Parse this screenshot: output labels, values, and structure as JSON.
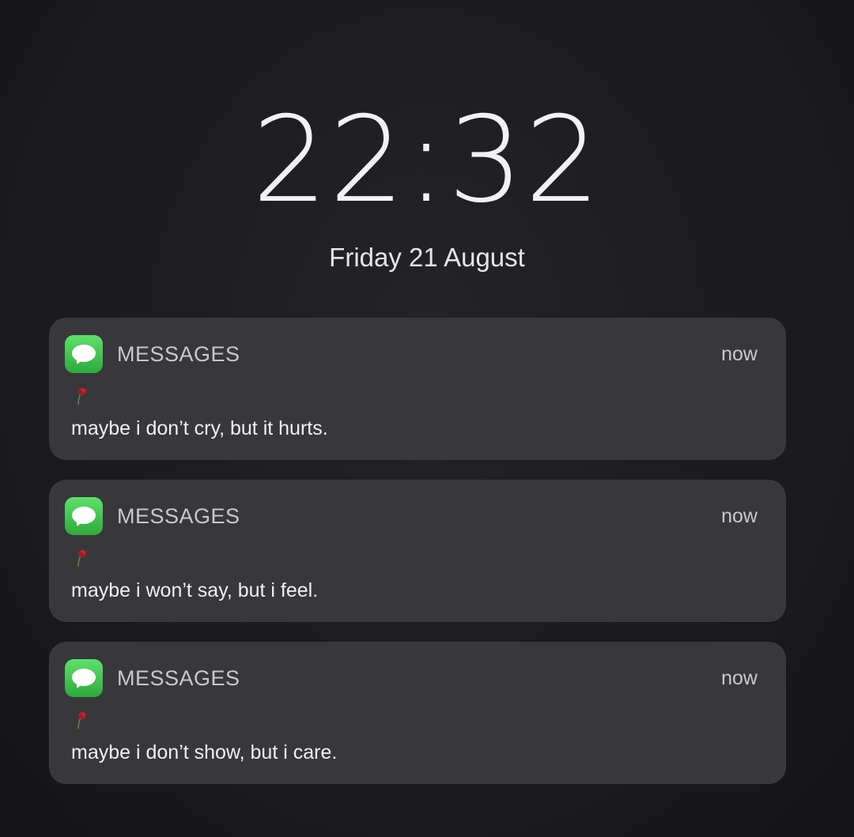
{
  "lock_screen": {
    "time": "22:32",
    "date": "Friday 21 August"
  },
  "notifications": [
    {
      "app_name": "MESSAGES",
      "app_icon": "messages-icon",
      "time": "now",
      "sender_icon": "rose-emoji",
      "message": "maybe i don’t cry, but it hurts."
    },
    {
      "app_name": "MESSAGES",
      "app_icon": "messages-icon",
      "time": "now",
      "sender_icon": "rose-emoji",
      "message": "maybe i won’t say, but i feel."
    },
    {
      "app_name": "MESSAGES",
      "app_icon": "messages-icon",
      "time": "now",
      "sender_icon": "rose-emoji",
      "message": "maybe i don’t show, but i care."
    }
  ],
  "colors": {
    "background": "#1c1c1e",
    "card": "#38383b",
    "messages_green": "#34c759"
  }
}
